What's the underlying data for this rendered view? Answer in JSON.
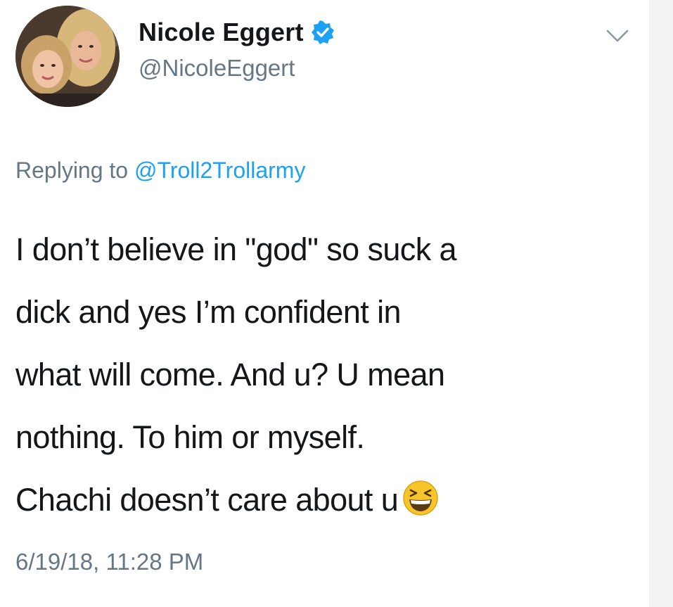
{
  "tweet": {
    "author": {
      "display_name": "Nicole Eggert",
      "handle": "@NicoleEggert",
      "verified": true,
      "verified_icon": "verified-badge-icon",
      "avatar": "profile-photo"
    },
    "menu_icon": "chevron-down-icon",
    "reply": {
      "prefix": "Replying to",
      "target_handle": "@Troll2Trollarmy"
    },
    "text_lines": [
      "I don’t believe in \"god\" so suck a",
      "dick and yes I’m confident in",
      "what will come. And u? U mean",
      "nothing. To him or myself.",
      "Chachi doesn’t care about u"
    ],
    "emoji": "grinning-squinting-face",
    "timestamp": "6/19/18, 11:28 PM"
  },
  "colors": {
    "text_primary": "#14171a",
    "text_secondary": "#657786",
    "link": "#1da1f2",
    "verified": "#1da1f2",
    "background": "#ffffff"
  }
}
